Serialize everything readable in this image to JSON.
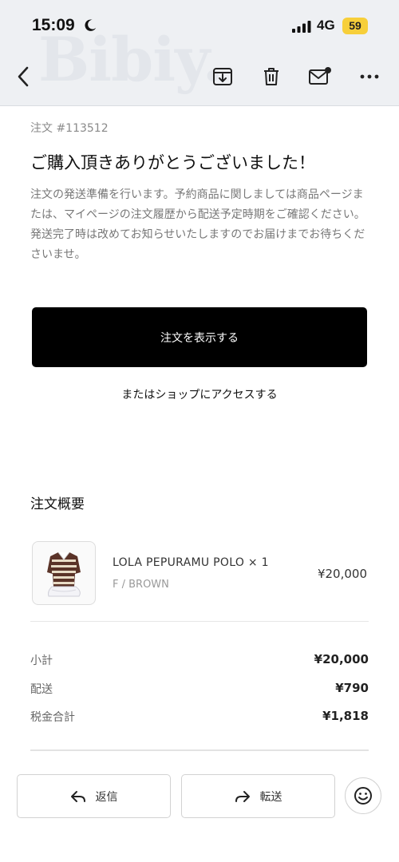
{
  "status_bar": {
    "time": "15:09",
    "network": "4G",
    "battery": "59"
  },
  "watermark": "Bibiy.",
  "toolbar": {
    "back_icon": "chevron-left-icon",
    "icons": [
      "archive-download-icon",
      "trash-icon",
      "mail-unread-icon",
      "more-horizontal-icon"
    ]
  },
  "email": {
    "order_number": "注文 #113512",
    "title": "ご購入頂きありがとうございました！",
    "message": "注文の発送準備を行います。予約商品に関しましては商品ページまたは、マイページの注文履歴から配送予定時期をご確認ください。発送完了時は改めてお知らせいたしますのでお届けまでお待ちくださいませ。",
    "view_order_label": "注文を表示する",
    "shop_link_label": "またはショップにアクセスする",
    "summary_title": "注文概要",
    "product": {
      "name": "LOLA PEPURAMU POLO × 1",
      "variant": "F / BROWN",
      "price": "¥20,000"
    },
    "summary": {
      "subtotal_label": "小計",
      "subtotal_value": "¥20,000",
      "shipping_label": "配送",
      "shipping_value": "¥790",
      "tax_label": "税金合計",
      "tax_value": "¥1,818"
    }
  },
  "actions": {
    "reply_label": "返信",
    "forward_label": "転送"
  },
  "colors": {
    "topbar_bg": "#eef0f3",
    "battery": "#f7cf3a",
    "primary_button": "#000000"
  }
}
